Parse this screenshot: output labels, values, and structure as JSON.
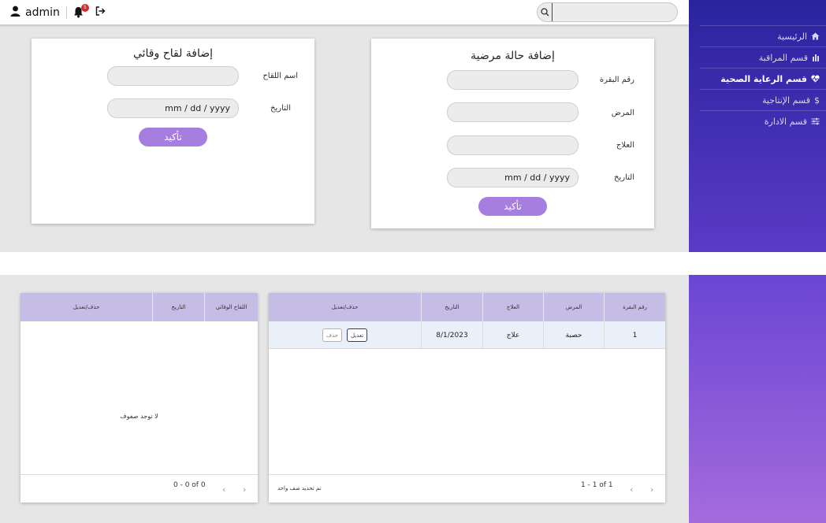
{
  "header": {
    "username": "admin",
    "notification_count": "5",
    "search_placeholder": ""
  },
  "sidebar": {
    "items": [
      {
        "label": "الرئيسية",
        "icon": "home-icon"
      },
      {
        "label": "قسم المراقبة",
        "icon": "bar-chart-icon"
      },
      {
        "label": "قسم الرعاية الصحية",
        "icon": "heartbeat-icon",
        "active": true
      },
      {
        "label": "قسم الإنتاجية",
        "icon": "dollar-icon"
      },
      {
        "label": "قسم الادارة",
        "icon": "sliders-icon"
      }
    ]
  },
  "disease_form": {
    "title": "إضافة حالة مرضية",
    "cow_number_label": "رقم البقرة",
    "disease_label": "المرض",
    "treatment_label": "العلاج",
    "date_label": "التاريخ",
    "date_placeholder": "mm / dd / yyyy",
    "submit_label": "تأكيد"
  },
  "vaccine_form": {
    "title": "إضافة لقاح وقائي",
    "vaccine_name_label": "اسم اللقاح",
    "date_label": "التاريخ",
    "date_placeholder": "mm / dd / yyyy",
    "submit_label": "تأكيد"
  },
  "disease_table": {
    "columns": [
      "رقم البقرة",
      "المرض",
      "العلاج",
      "التاريخ",
      "حذف/تعديل"
    ],
    "rows": [
      {
        "cow_number": "1",
        "disease": "حصبة",
        "treatment": "علاج",
        "date": "8/1/2023",
        "edit_label": "تعديل",
        "delete_label": "حذف"
      }
    ],
    "selection_note": "تم تحديد صف واحد",
    "pagination": "1 - 1 of 1"
  },
  "vaccine_table": {
    "columns": [
      "اللقاح الوقائي",
      "التاريخ",
      "حذف/تعديل"
    ],
    "empty_message": "لا توجد صفوف",
    "pagination": "0 - 0 of 0"
  },
  "colors": {
    "accent": "#a57ee0",
    "sidebar_top": "#2a249e",
    "sidebar_bottom": "#a46bdd",
    "table_header": "#c6bde6",
    "badge": "#d72c2c"
  }
}
